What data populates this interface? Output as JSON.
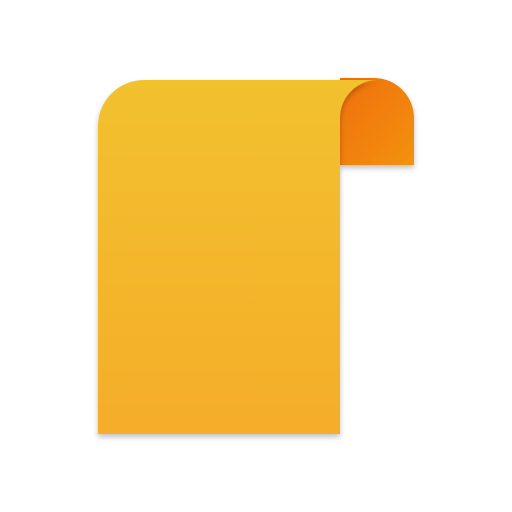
{
  "icon": {
    "name": "scroll-note-icon",
    "colors": {
      "page_top": "#f2c12e",
      "page_bottom": "#f5ad2b",
      "curl_light": "#f39208",
      "curl_dark": "#ef6f0f",
      "background": "#ffffff"
    }
  }
}
